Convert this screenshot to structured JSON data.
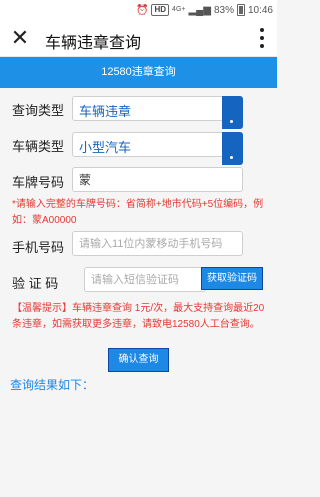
{
  "statusbar": {
    "hd": "HD",
    "network": "4G+",
    "battery": "83%",
    "time": "10:46"
  },
  "appbar": {
    "title": "车辆违章查询"
  },
  "banner": {
    "text": "12580违章查询"
  },
  "form": {
    "query_type": {
      "label": "查询类型",
      "value": "车辆违章"
    },
    "vehicle_type": {
      "label": "车辆类型",
      "value": "小型汽车"
    },
    "plate": {
      "label": "车牌号码",
      "value": "蒙"
    },
    "plate_hint": "*请输入完整的车牌号码：省简称+地市代码+5位编码，例如：蒙A00000",
    "phone": {
      "label": "手机号码",
      "placeholder": "请输入11位内蒙移动手机号码"
    },
    "code": {
      "label": "验 证 码",
      "placeholder": "请输入短信验证码",
      "button": "获取验证码"
    }
  },
  "notice": "【温馨提示】车辆违章查询 1元/次，最大支持查询最近20条违章，如需获取更多违章，请致电12580人工台查询。",
  "confirm_button": "确认查询",
  "result_title": "查询结果如下："
}
